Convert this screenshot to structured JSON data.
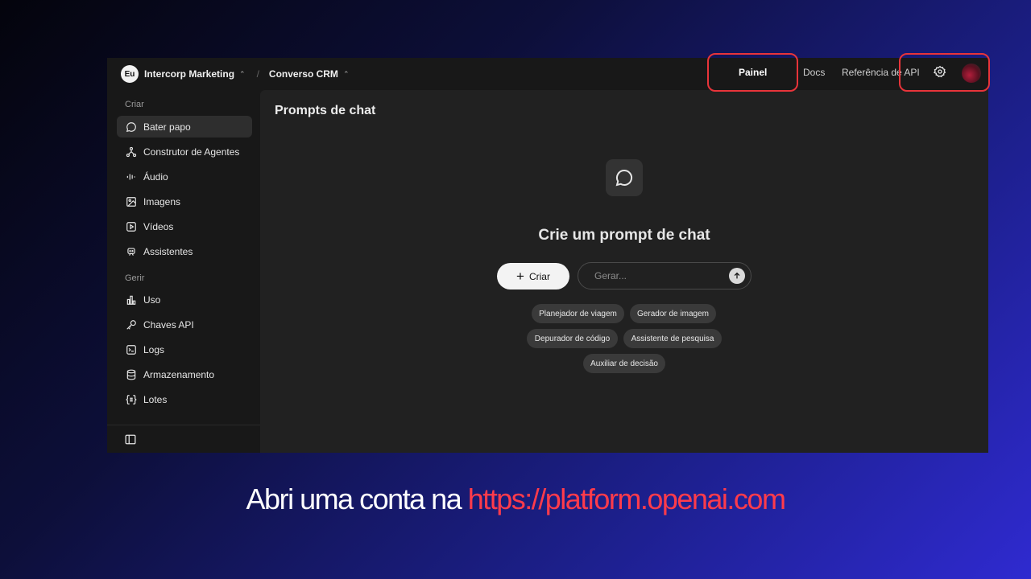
{
  "header": {
    "org_initials": "Eu",
    "org_name": "Intercorp Marketing",
    "separator": "/",
    "project_name": "Converso CRM",
    "nav": {
      "painel": "Painel",
      "docs": "Docs",
      "api_ref": "Referência de API"
    }
  },
  "sidebar": {
    "sections": [
      {
        "title": "Criar",
        "items": [
          {
            "label": "Bater papo",
            "icon": "chat-bubble-icon",
            "active": true
          },
          {
            "label": "Construtor de Agentes",
            "icon": "agent-nodes-icon"
          },
          {
            "label": "Áudio",
            "icon": "audio-wave-icon"
          },
          {
            "label": "Imagens",
            "icon": "image-icon"
          },
          {
            "label": "Vídeos",
            "icon": "video-play-icon"
          },
          {
            "label": "Assistentes",
            "icon": "assistant-robot-icon"
          }
        ]
      },
      {
        "title": "Gerir",
        "items": [
          {
            "label": "Uso",
            "icon": "bar-chart-icon"
          },
          {
            "label": "Chaves API",
            "icon": "key-icon"
          },
          {
            "label": "Logs",
            "icon": "terminal-icon"
          },
          {
            "label": "Armazenamento",
            "icon": "database-icon"
          },
          {
            "label": "Lotes",
            "icon": "braces-list-icon"
          }
        ]
      }
    ]
  },
  "main": {
    "page_title": "Prompts de chat",
    "hero_title": "Crie um prompt de chat",
    "create_label": "Criar",
    "generate_placeholder": "Gerar...",
    "chips": [
      "Planejador de viagem",
      "Gerador de imagem",
      "Depurador de código",
      "Assistente de pesquisa",
      "Auxiliar de decisão"
    ]
  },
  "caption": {
    "text": "Abri uma conta na ",
    "link": "https://platform.openai.com"
  },
  "colors": {
    "highlight": "#e8343a",
    "link": "#ff3b4b",
    "panel_bg": "#181818",
    "main_bg": "#212121"
  }
}
